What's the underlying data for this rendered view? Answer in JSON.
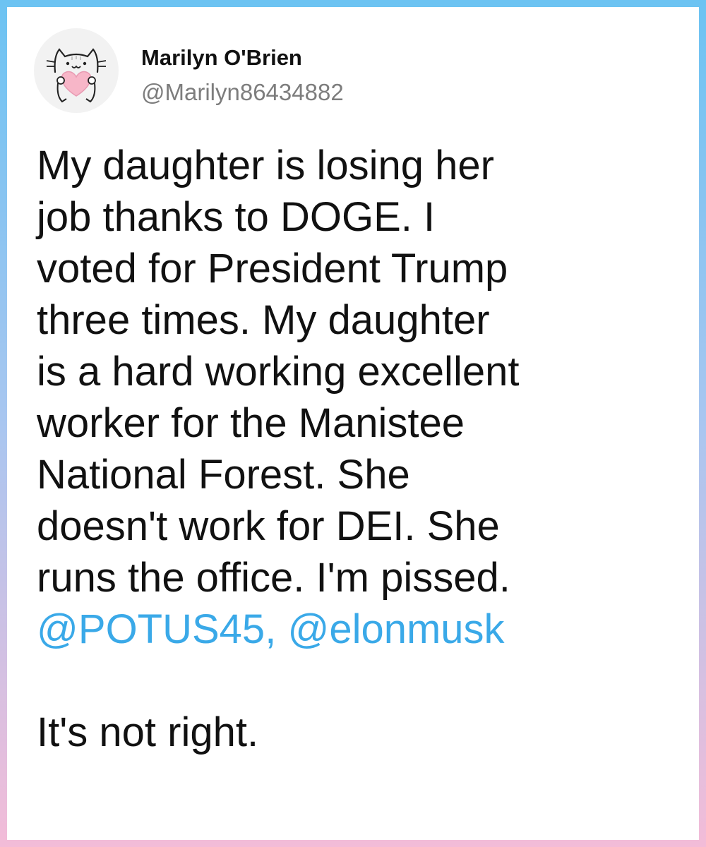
{
  "post": {
    "author_name": "Marilyn O'Brien",
    "author_handle": "@Marilyn86434882",
    "avatar_icon": "cat-holding-heart-avatar",
    "text_lines": [
      "My daughter is losing her",
      "job thanks to DOGE. I",
      "voted for President Trump",
      "three times. My daughter",
      "is a hard working excellent",
      "worker for the Manistee",
      "National Forest. She",
      "doesn't work for DEI. She",
      "runs the office. I'm pissed."
    ],
    "mentions": {
      "first": "@POTUS45",
      "separator": ", ",
      "second": "@elonmusk"
    },
    "closing_line": "It's not right."
  },
  "colors": {
    "mention": "#3aa9e8",
    "border_top": "#6cc3f2",
    "border_bottom": "#f3bcd8"
  }
}
